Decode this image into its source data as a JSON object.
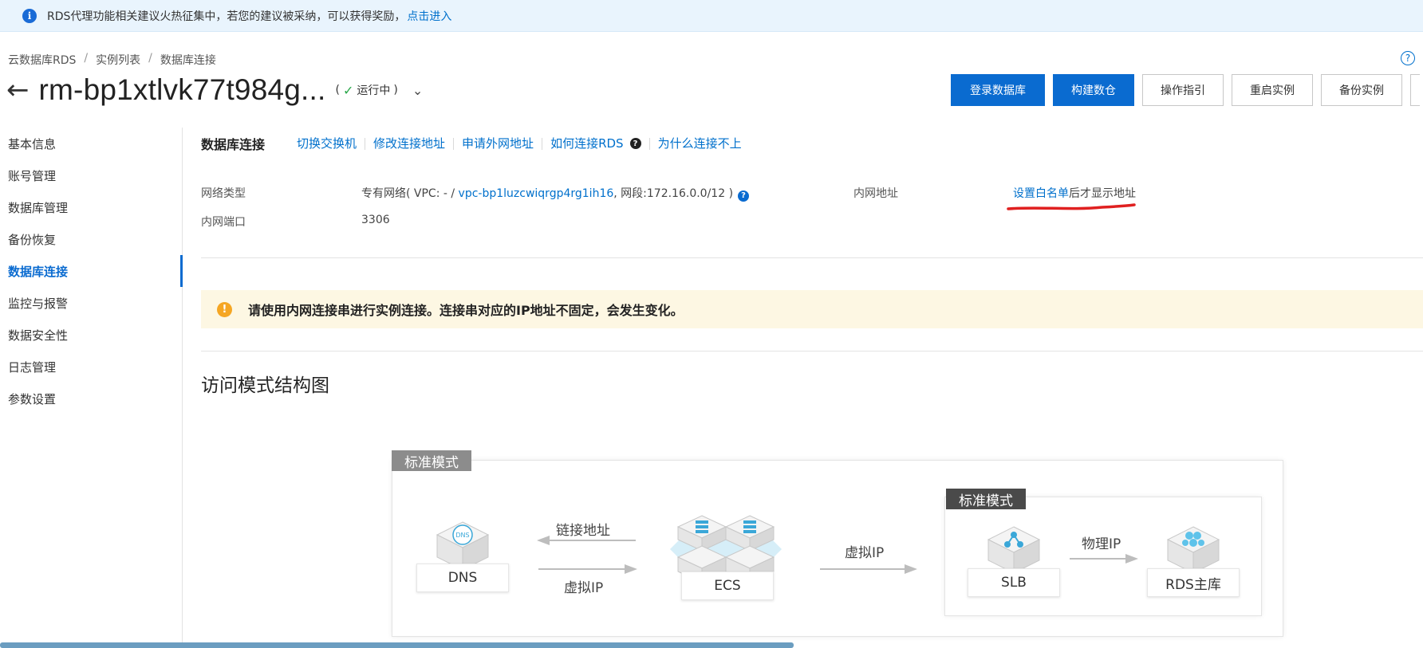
{
  "notice": {
    "text": "RDS代理功能相关建议火热征集中，若您的建议被采纳，可以获得奖励，",
    "link": "点击进入"
  },
  "breadcrumb": [
    "云数据库RDS",
    "实例列表",
    "数据库连接"
  ],
  "instance": {
    "name": "rm-bp1xtlvk77t984g...",
    "status_open": "(",
    "status": "运行中",
    "status_close": ")"
  },
  "actions": {
    "login_db": "登录数据库",
    "build_warehouse": "构建数仓",
    "guide": "操作指引",
    "restart": "重启实例",
    "backup": "备份实例"
  },
  "sidebar": {
    "items": [
      {
        "label": "基本信息"
      },
      {
        "label": "账号管理"
      },
      {
        "label": "数据库管理"
      },
      {
        "label": "备份恢复"
      },
      {
        "label": "数据库连接"
      },
      {
        "label": "监控与报警"
      },
      {
        "label": "数据安全性"
      },
      {
        "label": "日志管理"
      },
      {
        "label": "参数设置"
      }
    ],
    "active_index": 4
  },
  "tabs": {
    "title": "数据库连接",
    "links": [
      "切换交换机",
      "修改连接地址",
      "申请外网地址",
      "如何连接RDS",
      "为什么连接不上"
    ]
  },
  "info": {
    "network_type_label": "网络类型",
    "network_type_prefix": "专有网络( VPC: - / ",
    "vpc_link": "vpc-bp1luzcwiqrgp4rg1ih16",
    "network_type_suffix": ", 网段:172.16.0.0/12 )",
    "port_label": "内网端口",
    "port_value": "3306",
    "intranet_label": "内网地址",
    "intranet_link": "设置白名单",
    "intranet_suffix": "后才显示地址"
  },
  "warning": {
    "text": "请使用内网连接串进行实例连接。连接串对应的IP地址不固定，会发生变化。"
  },
  "diagram": {
    "title": "访问模式结构图",
    "outer_mode": "标准模式",
    "inner_mode": "标准模式",
    "dns": "DNS",
    "ecs": "ECS",
    "slb": "SLB",
    "rds": "RDS主库",
    "arrow_link_addr": "链接地址",
    "arrow_virtual_ip_1": "虚拟IP",
    "arrow_virtual_ip_2": "虚拟IP",
    "arrow_physical_ip": "物理IP",
    "dns_badge": "DNS"
  },
  "colors": {
    "primary": "#0a6bd0",
    "link": "#0070cc",
    "warning_bg": "#fdf7e3",
    "notice_bg": "#e9f4fd",
    "annotation_red": "#e02020"
  }
}
